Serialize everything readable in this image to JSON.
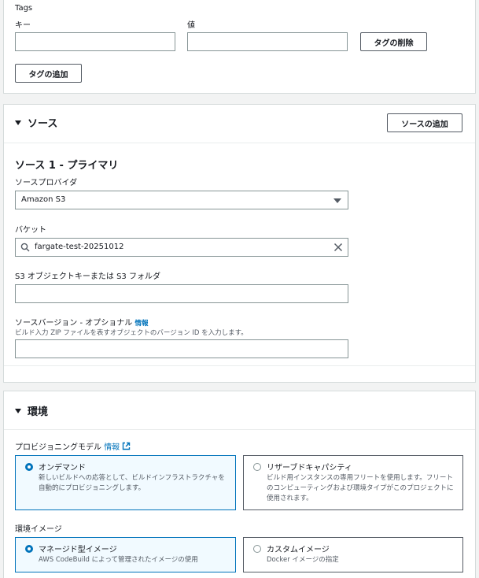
{
  "tags": {
    "title": "Tags",
    "key_label": "キー",
    "value_label": "値",
    "key_value": "",
    "value_value": "",
    "remove_button": "タグの削除",
    "add_button": "タグの追加"
  },
  "source": {
    "section_title": "ソース",
    "add_source_button": "ソースの追加",
    "subheading": "ソース 1 - プライマリ",
    "provider_label": "ソースプロバイダ",
    "provider_value": "Amazon S3",
    "bucket_label": "バケット",
    "bucket_value": "fargate-test-20251012",
    "s3_key_label": "S3 オブジェクトキーまたは S3 フォルダ",
    "s3_key_value": "",
    "version_label": "ソースバージョン - オプショナル",
    "version_info": "情報",
    "version_desc": "ビルド入力 ZIP ファイルを表すオブジェクトのバージョン ID を入力します。",
    "version_value": ""
  },
  "environment": {
    "section_title": "環境",
    "provisioning_label": "プロビジョニングモデル",
    "provisioning_info": "情報",
    "ondemand_title": "オンデマンド",
    "ondemand_desc": "新しいビルドへの応答として、ビルドインフラストラクチャを自動的にプロビジョニングします。",
    "reserved_title": "リザーブドキャパシティ",
    "reserved_desc": "ビルド用インスタンスの専用フリートを使用します。フリートのコンピューティングおよび環境タイプがこのプロジェクトに使用されます。",
    "image_label": "環境イメージ",
    "managed_title": "マネージド型イメージ",
    "managed_desc": "AWS CodeBuild によって管理されたイメージの使用",
    "custom_title": "カスタムイメージ",
    "custom_desc": "Docker イメージの指定"
  },
  "colors": {
    "accent": "#0073bb",
    "border": "#545b64",
    "selected_bg": "#f1faff"
  }
}
